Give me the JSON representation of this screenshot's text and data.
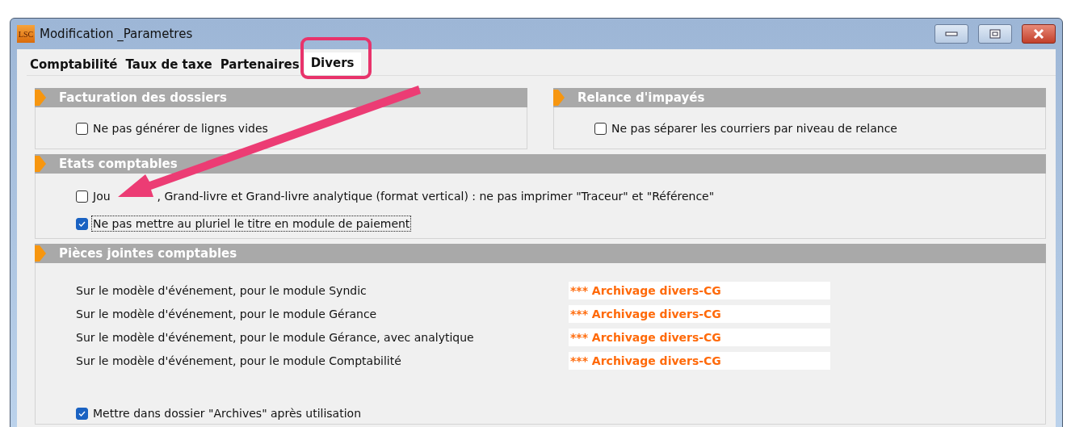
{
  "window": {
    "title": "Modification _Parametres",
    "logo": "LSC"
  },
  "tabs": [
    {
      "label": "Comptabilité",
      "selected": false
    },
    {
      "label": "Taux de taxe",
      "selected": false
    },
    {
      "label": "Partenaires",
      "selected": false
    },
    {
      "label": "Divers",
      "selected": true
    }
  ],
  "top_sections": [
    {
      "title": "Facturation des dossiers",
      "options": [
        {
          "label": "Ne pas générer de lignes vides",
          "checked": false,
          "focused": false
        }
      ]
    },
    {
      "title": "Relance d'impayés",
      "options": [
        {
          "label": "Ne pas séparer les courriers par niveau de relance",
          "checked": false,
          "focused": false
        }
      ]
    }
  ],
  "etats": {
    "title": "Etats comptables",
    "options": [
      {
        "label": "Jou",
        "label_after_arrow": ", Grand-livre et Grand-livre analytique (format vertical) : ne pas imprimer \"Traceur\" et \"Référence\"",
        "checked": false,
        "focused": false
      },
      {
        "label": "Ne pas mettre au pluriel le titre en module de paiement",
        "checked": true,
        "focused": true
      }
    ]
  },
  "pieces": {
    "title": "Pièces jointes comptables",
    "rows": [
      {
        "label": "Sur le modèle d'événement, pour le module Syndic",
        "value": "*** Archivage divers-CG"
      },
      {
        "label": "Sur le modèle d'événement, pour le module Gérance",
        "value": "*** Archivage divers-CG"
      },
      {
        "label": "Sur le modèle d'événement, pour le module Gérance, avec analytique",
        "value": "*** Archivage divers-CG"
      },
      {
        "label": "Sur le modèle d'événement, pour le module Comptabilité",
        "value": "*** Archivage divers-CG"
      }
    ],
    "options": [
      {
        "label": "Mettre dans dossier \"Archives\" après utilisation",
        "checked": true,
        "focused": false
      }
    ]
  }
}
